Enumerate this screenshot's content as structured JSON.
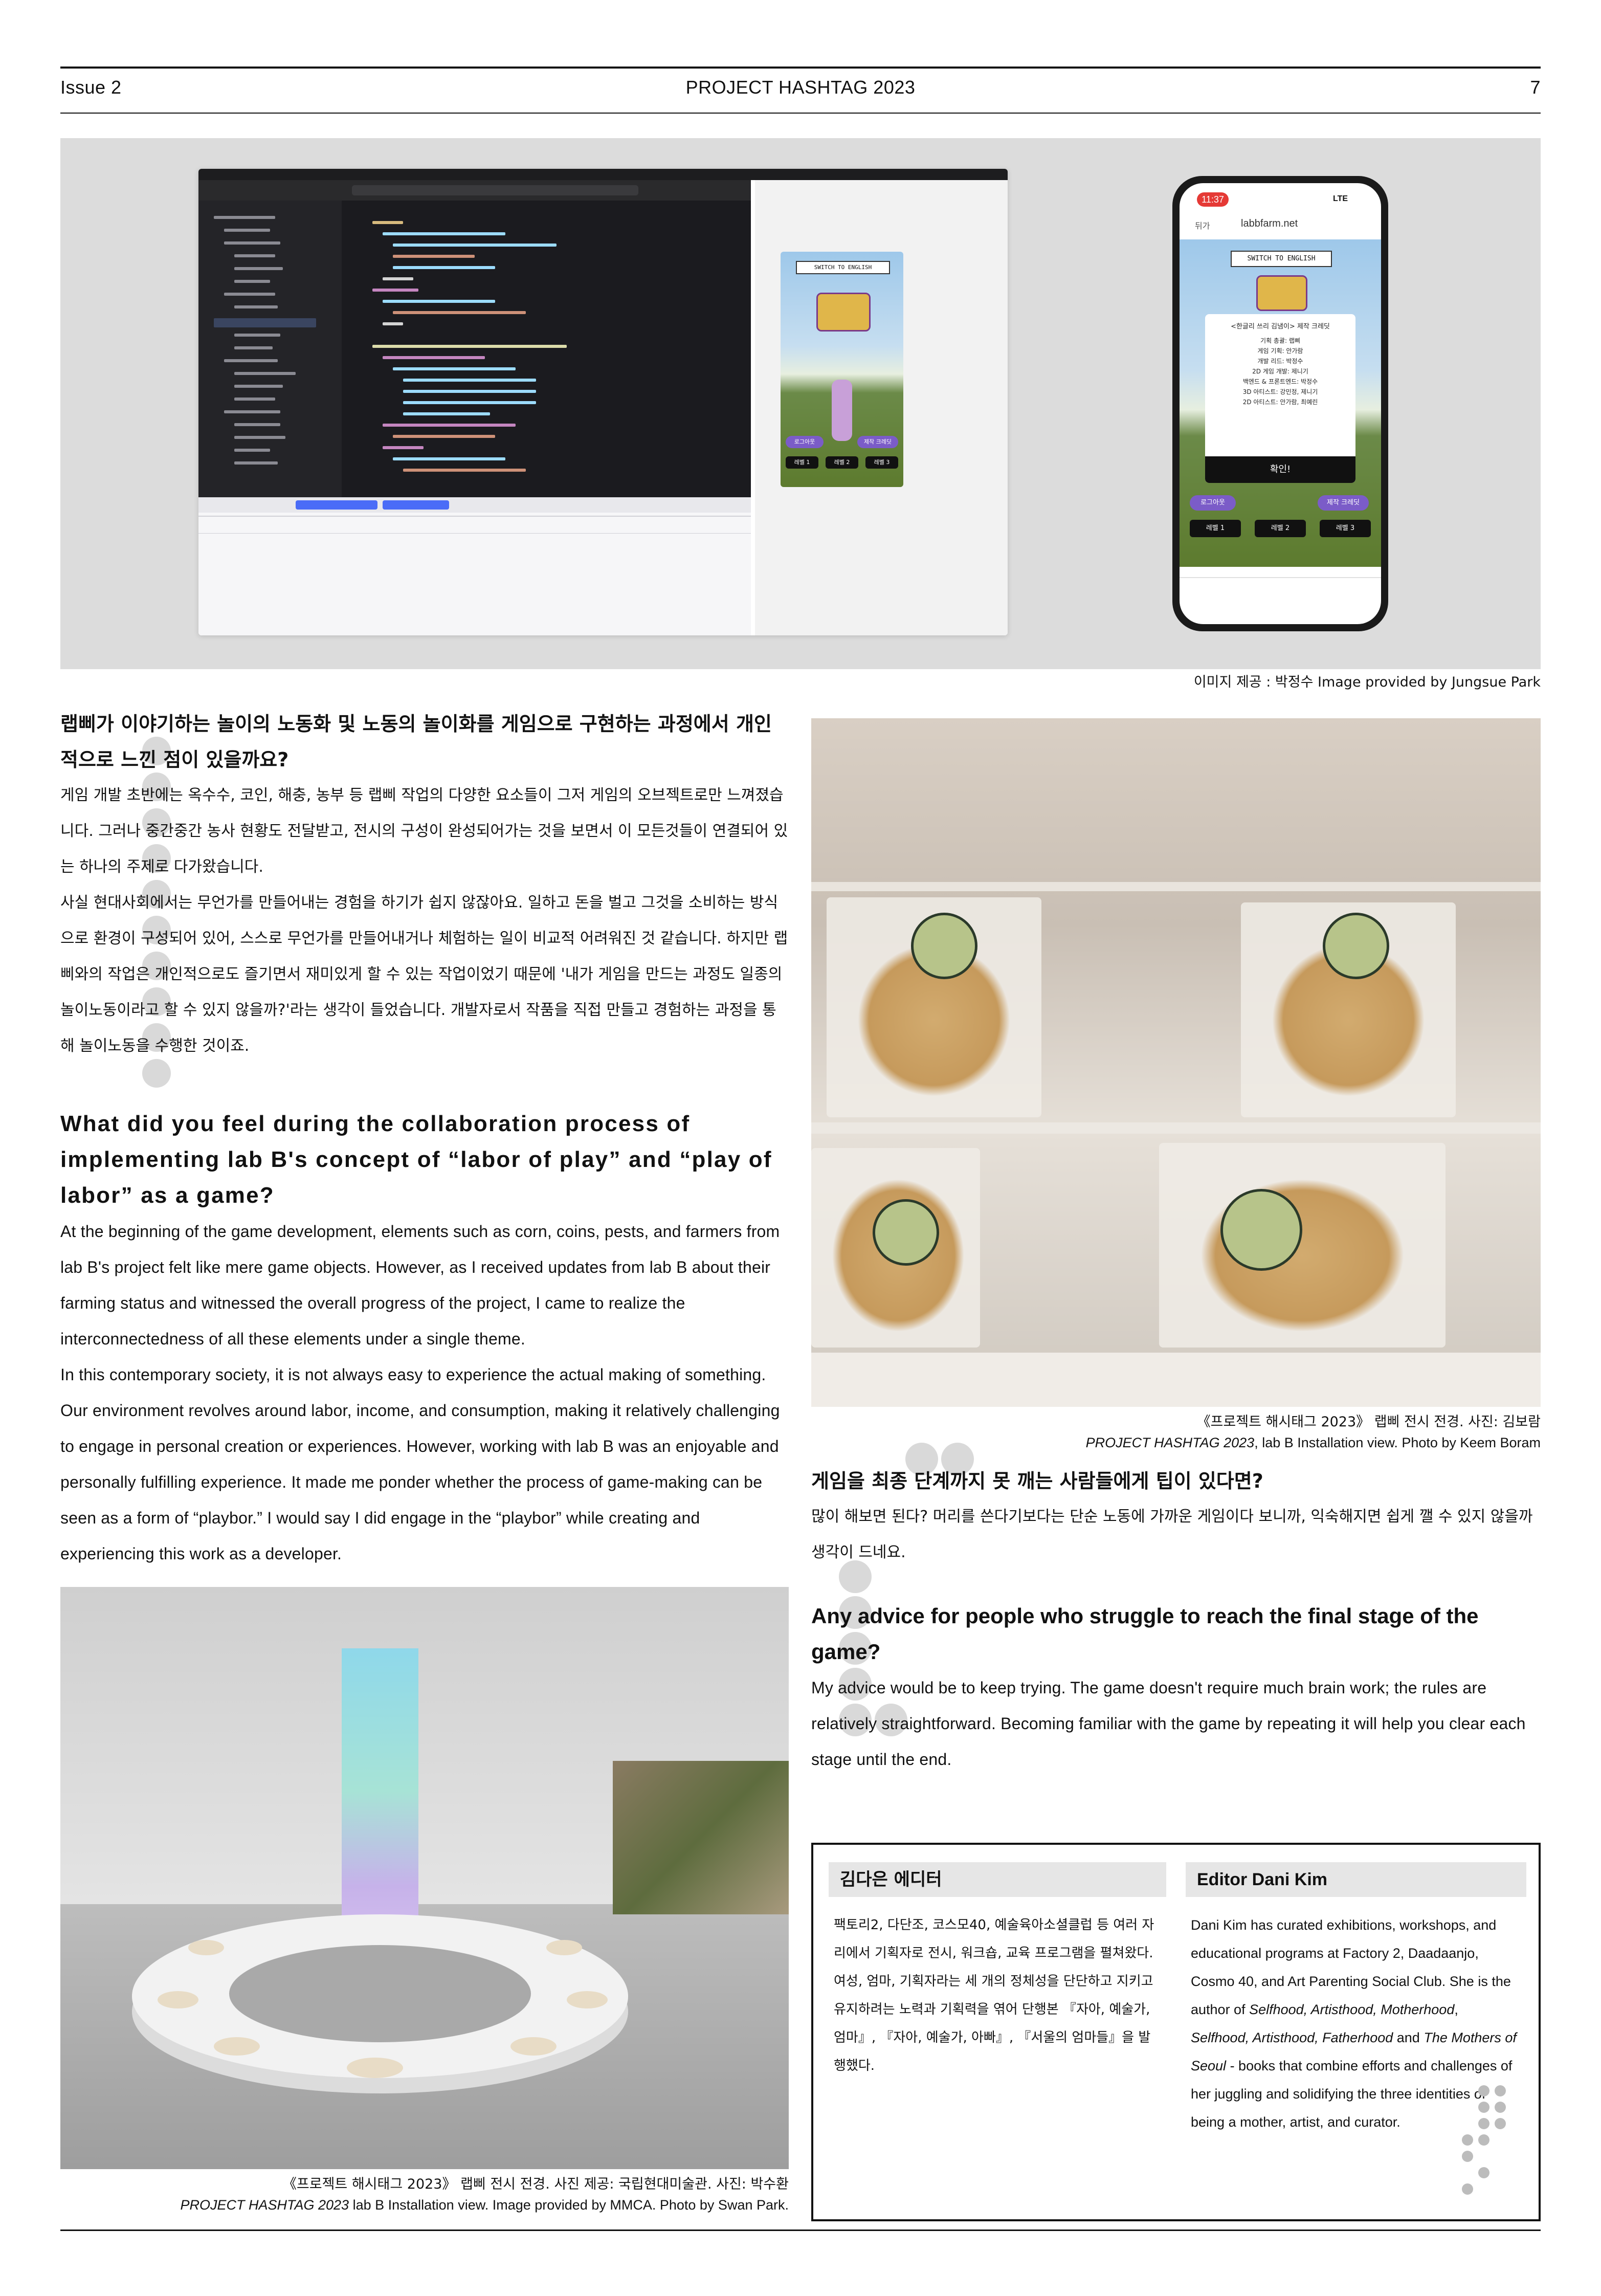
{
  "header": {
    "issue": "Issue 2",
    "title": "PROJECT HASHTAG 2023",
    "page_number": "7"
  },
  "hero": {
    "caption": "이미지 제공 : 박정수 Image provided by Jungsue Park",
    "game_preview": {
      "switch_label": "SWITCH TO ENGLISH",
      "logout_label": "로그아웃",
      "credits_label": "제작 크레딧",
      "level_buttons": [
        "레벨 1",
        "레벨 2",
        "레벨 3"
      ]
    },
    "phone": {
      "time": "11:37",
      "status": "LTE",
      "back_label": "뒤가",
      "url": "labbfarm.net",
      "switch_label": "SWITCH TO ENGLISH",
      "credits_title": "<한글리 쓰리 김냄이> 제작 크레딧",
      "credit_lines": [
        "기획 총괄: 랩삐",
        "게임 기획: 안가람",
        "개발 리드: 박정수",
        "2D 게임 개발: 제니기",
        "백엔드 & 프론트엔드: 박정수",
        "3D 아티스트: 강민정, 제니기",
        "2D 아티스트: 안가람, 최예린"
      ],
      "confirm_label": "확인!",
      "logout_label": "로그아웃",
      "credits_label": "제작 크레딧",
      "level_buttons": [
        "레벨 1",
        "레벨 2",
        "레벨 3"
      ]
    }
  },
  "left_column": {
    "q1_ko": "랩삐가 이야기하는 놀이의 노동화 및 노동의 놀이화를 게임으로 구현하는 과정에서 개인적으로 느낀 점이 있을까요?",
    "a1_ko_p1": "게임 개발 초반에는 옥수수, 코인, 해충, 농부 등 랩삐 작업의 다양한 요소들이 그저 게임의 오브젝트로만 느껴졌습니다. 그러나 중간중간 농사 현황도 전달받고, 전시의 구성이 완성되어가는 것을 보면서 이 모든것들이 연결되어 있는 하나의 주제로 다가왔습니다.",
    "a1_ko_p2": "사실 현대사회에서는 무언가를 만들어내는 경험을 하기가 쉽지 않잖아요. 일하고 돈을 벌고 그것을 소비하는 방식으로 환경이 구성되어 있어, 스스로 무언가를 만들어내거나 체험하는 일이 비교적 어려워진 것 같습니다. 하지만 랩삐와의 작업은 개인적으로도 즐기면서 재미있게 할 수 있는 작업이었기 때문에 '내가 게임을 만드는 과정도 일종의 놀이노동이라고 할 수 있지 않을까?'라는 생각이 들었습니다. 개발자로서 작품을 직접 만들고 경험하는 과정을 통해 놀이노동을 수행한 것이죠.",
    "q1_en": "What did you feel during the collaboration process of implementing lab B's concept of “labor of play” and “play of labor” as a game?",
    "a1_en_p1": "At the beginning of the game development, elements such as corn, coins, pests, and farmers from lab B's project felt like mere game objects. However, as I received updates from lab B about their farming status and witnessed the overall progress of the project, I came to realize the interconnectedness of all these elements under a single theme.",
    "a1_en_p2": "In this contemporary society, it is not always easy to experience the actual making of something. Our environment revolves around labor, income, and consumption, making it relatively challenging to engage in personal creation or experiences. However, working with lab B was an enjoyable and personally fulfilling experience. It made me ponder whether the process of game-making can be seen as a form of “playbor.” I would say I did engage in the “playbor” while creating and experiencing this work as a developer."
  },
  "room_photo": {
    "caption_ko": "《프로젝트 해시태그 2023》 랩삐 전시 전경. 사진 제공: 국립현대미술관. 사진: 박수환",
    "caption_en_title": "PROJECT HASHTAG 2023",
    "caption_en_rest": " lab B Installation view. Image provided by MMCA. Photo by Swan Park."
  },
  "shelf_photo": {
    "caption_ko": "《프로젝트 해시태그 2023》 랩삐 전시 전경. 사진: 김보람",
    "caption_en_title": "PROJECT HASHTAG 2023",
    "caption_en_rest": ", lab B Installation view. Photo by Keem Boram"
  },
  "right_column": {
    "q2_ko": "게임을 최종 단계까지 못 깨는 사람들에게 팁이 있다면?",
    "a2_ko": "많이 해보면 된다? 머리를 쓴다기보다는 단순 노동에 가까운 게임이다 보니까, 익숙해지면 쉽게 깰 수 있지 않을까 생각이 드네요.",
    "q2_en": "Any advice for people who struggle to reach the final stage of the game?",
    "a2_en": "My advice would be to keep trying. The game doesn't require much brain work; the rules are relatively straightforward. Becoming familiar with the game by repeating it will help you clear each stage until the end."
  },
  "editor": {
    "title_ko": "김다은 에디터",
    "bio_ko": "팩토리2, 다단조, 코스모40, 예술육아소셜클럽 등 여러 자리에서 기획자로 전시, 워크숍, 교육 프로그램을 펼쳐왔다. 여성, 엄마, 기획자라는 세 개의 정체성을 단단하고 지키고 유지하려는 노력과 기획력을 엮어 단행본 『자아, 예술가, 엄마』, 『자아, 예술가, 아빠』, 『서울의 엄마들』을 발행했다.",
    "title_en": "Editor Dani Kim",
    "bio_en_1": "Dani Kim has curated exhibitions, workshops, and educational programs at Factory 2, Daadaanjo, Cosmo 40, and Art Parenting Social Club. She is the author of ",
    "book_1": "Selfhood, Artisthood, Motherhood",
    "sep_1": ", ",
    "book_2": "Selfhood, Artisthood, Fatherhood",
    "sep_2": " and ",
    "book_3": "The Mothers of Seoul",
    "bio_en_2": " - books that combine efforts and challenges of her juggling and solidifying the three identities of being a mother, artist, and curator."
  }
}
